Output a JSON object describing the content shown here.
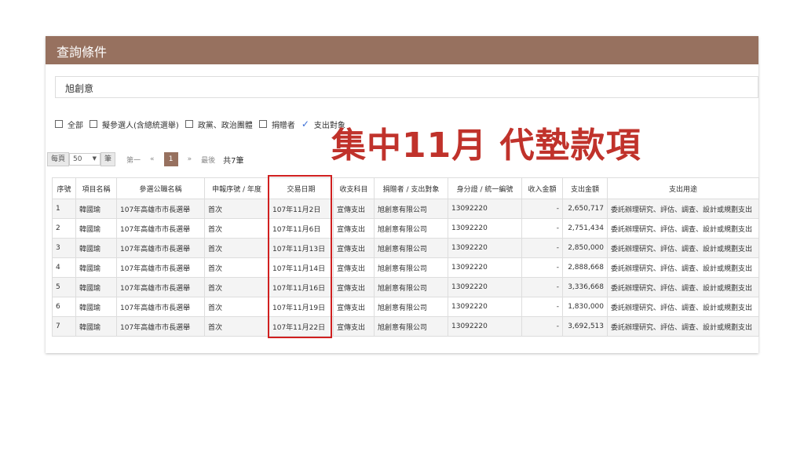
{
  "header": {
    "title": "查詢條件"
  },
  "search": {
    "value": "旭創意"
  },
  "filters": [
    {
      "label": "全部",
      "checked": false
    },
    {
      "label": "擬參選人(含總統選舉)",
      "checked": false
    },
    {
      "label": "政黨、政治團體",
      "checked": false
    },
    {
      "label": "捐贈者",
      "checked": false
    },
    {
      "label": "支出對象",
      "checked": true
    }
  ],
  "pager": {
    "per_page_label": "每頁",
    "per_page_value": "50",
    "unit": "筆",
    "first": "第一",
    "prev": "«",
    "current": "1",
    "next": "»",
    "last": "最後",
    "total": "共7筆"
  },
  "overlay_text": "集中11月 代墊款項",
  "table": {
    "columns": [
      "序號",
      "項目名稱",
      "參選公職名稱",
      "申報序號 / 年度",
      "交易日期",
      "收支科目",
      "捐贈者 / 支出對象",
      "身分證 / 統一編號",
      "收入金額",
      "支出金額",
      "支出用途"
    ],
    "rows": [
      [
        "1",
        "韓國瑜",
        "107年高雄市市長選舉",
        "首次",
        "107年11月2日",
        "宣傳支出",
        "旭創意有限公司",
        "13092220",
        "-",
        "2,650,717",
        "委託辦理研究、評估、調查、設計或規劃支出"
      ],
      [
        "2",
        "韓國瑜",
        "107年高雄市市長選舉",
        "首次",
        "107年11月6日",
        "宣傳支出",
        "旭創意有限公司",
        "13092220",
        "-",
        "2,751,434",
        "委託辦理研究、評估、調查、設計或規劃支出"
      ],
      [
        "3",
        "韓國瑜",
        "107年高雄市市長選舉",
        "首次",
        "107年11月13日",
        "宣傳支出",
        "旭創意有限公司",
        "13092220",
        "-",
        "2,850,000",
        "委託辦理研究、評估、調查、設計或規劃支出"
      ],
      [
        "4",
        "韓國瑜",
        "107年高雄市市長選舉",
        "首次",
        "107年11月14日",
        "宣傳支出",
        "旭創意有限公司",
        "13092220",
        "-",
        "2,888,668",
        "委託辦理研究、評估、調查、設計或規劃支出"
      ],
      [
        "5",
        "韓國瑜",
        "107年高雄市市長選舉",
        "首次",
        "107年11月16日",
        "宣傳支出",
        "旭創意有限公司",
        "13092220",
        "-",
        "3,336,668",
        "委託辦理研究、評估、調查、設計或規劃支出"
      ],
      [
        "6",
        "韓國瑜",
        "107年高雄市市長選舉",
        "首次",
        "107年11月19日",
        "宣傳支出",
        "旭創意有限公司",
        "13092220",
        "-",
        "1,830,000",
        "委託辦理研究、評估、調查、設計或規劃支出"
      ],
      [
        "7",
        "韓國瑜",
        "107年高雄市市長選舉",
        "首次",
        "107年11月22日",
        "宣傳支出",
        "旭創意有限公司",
        "13092220",
        "-",
        "3,692,513",
        "委託辦理研究、評估、調查、設計或規劃支出"
      ]
    ]
  }
}
